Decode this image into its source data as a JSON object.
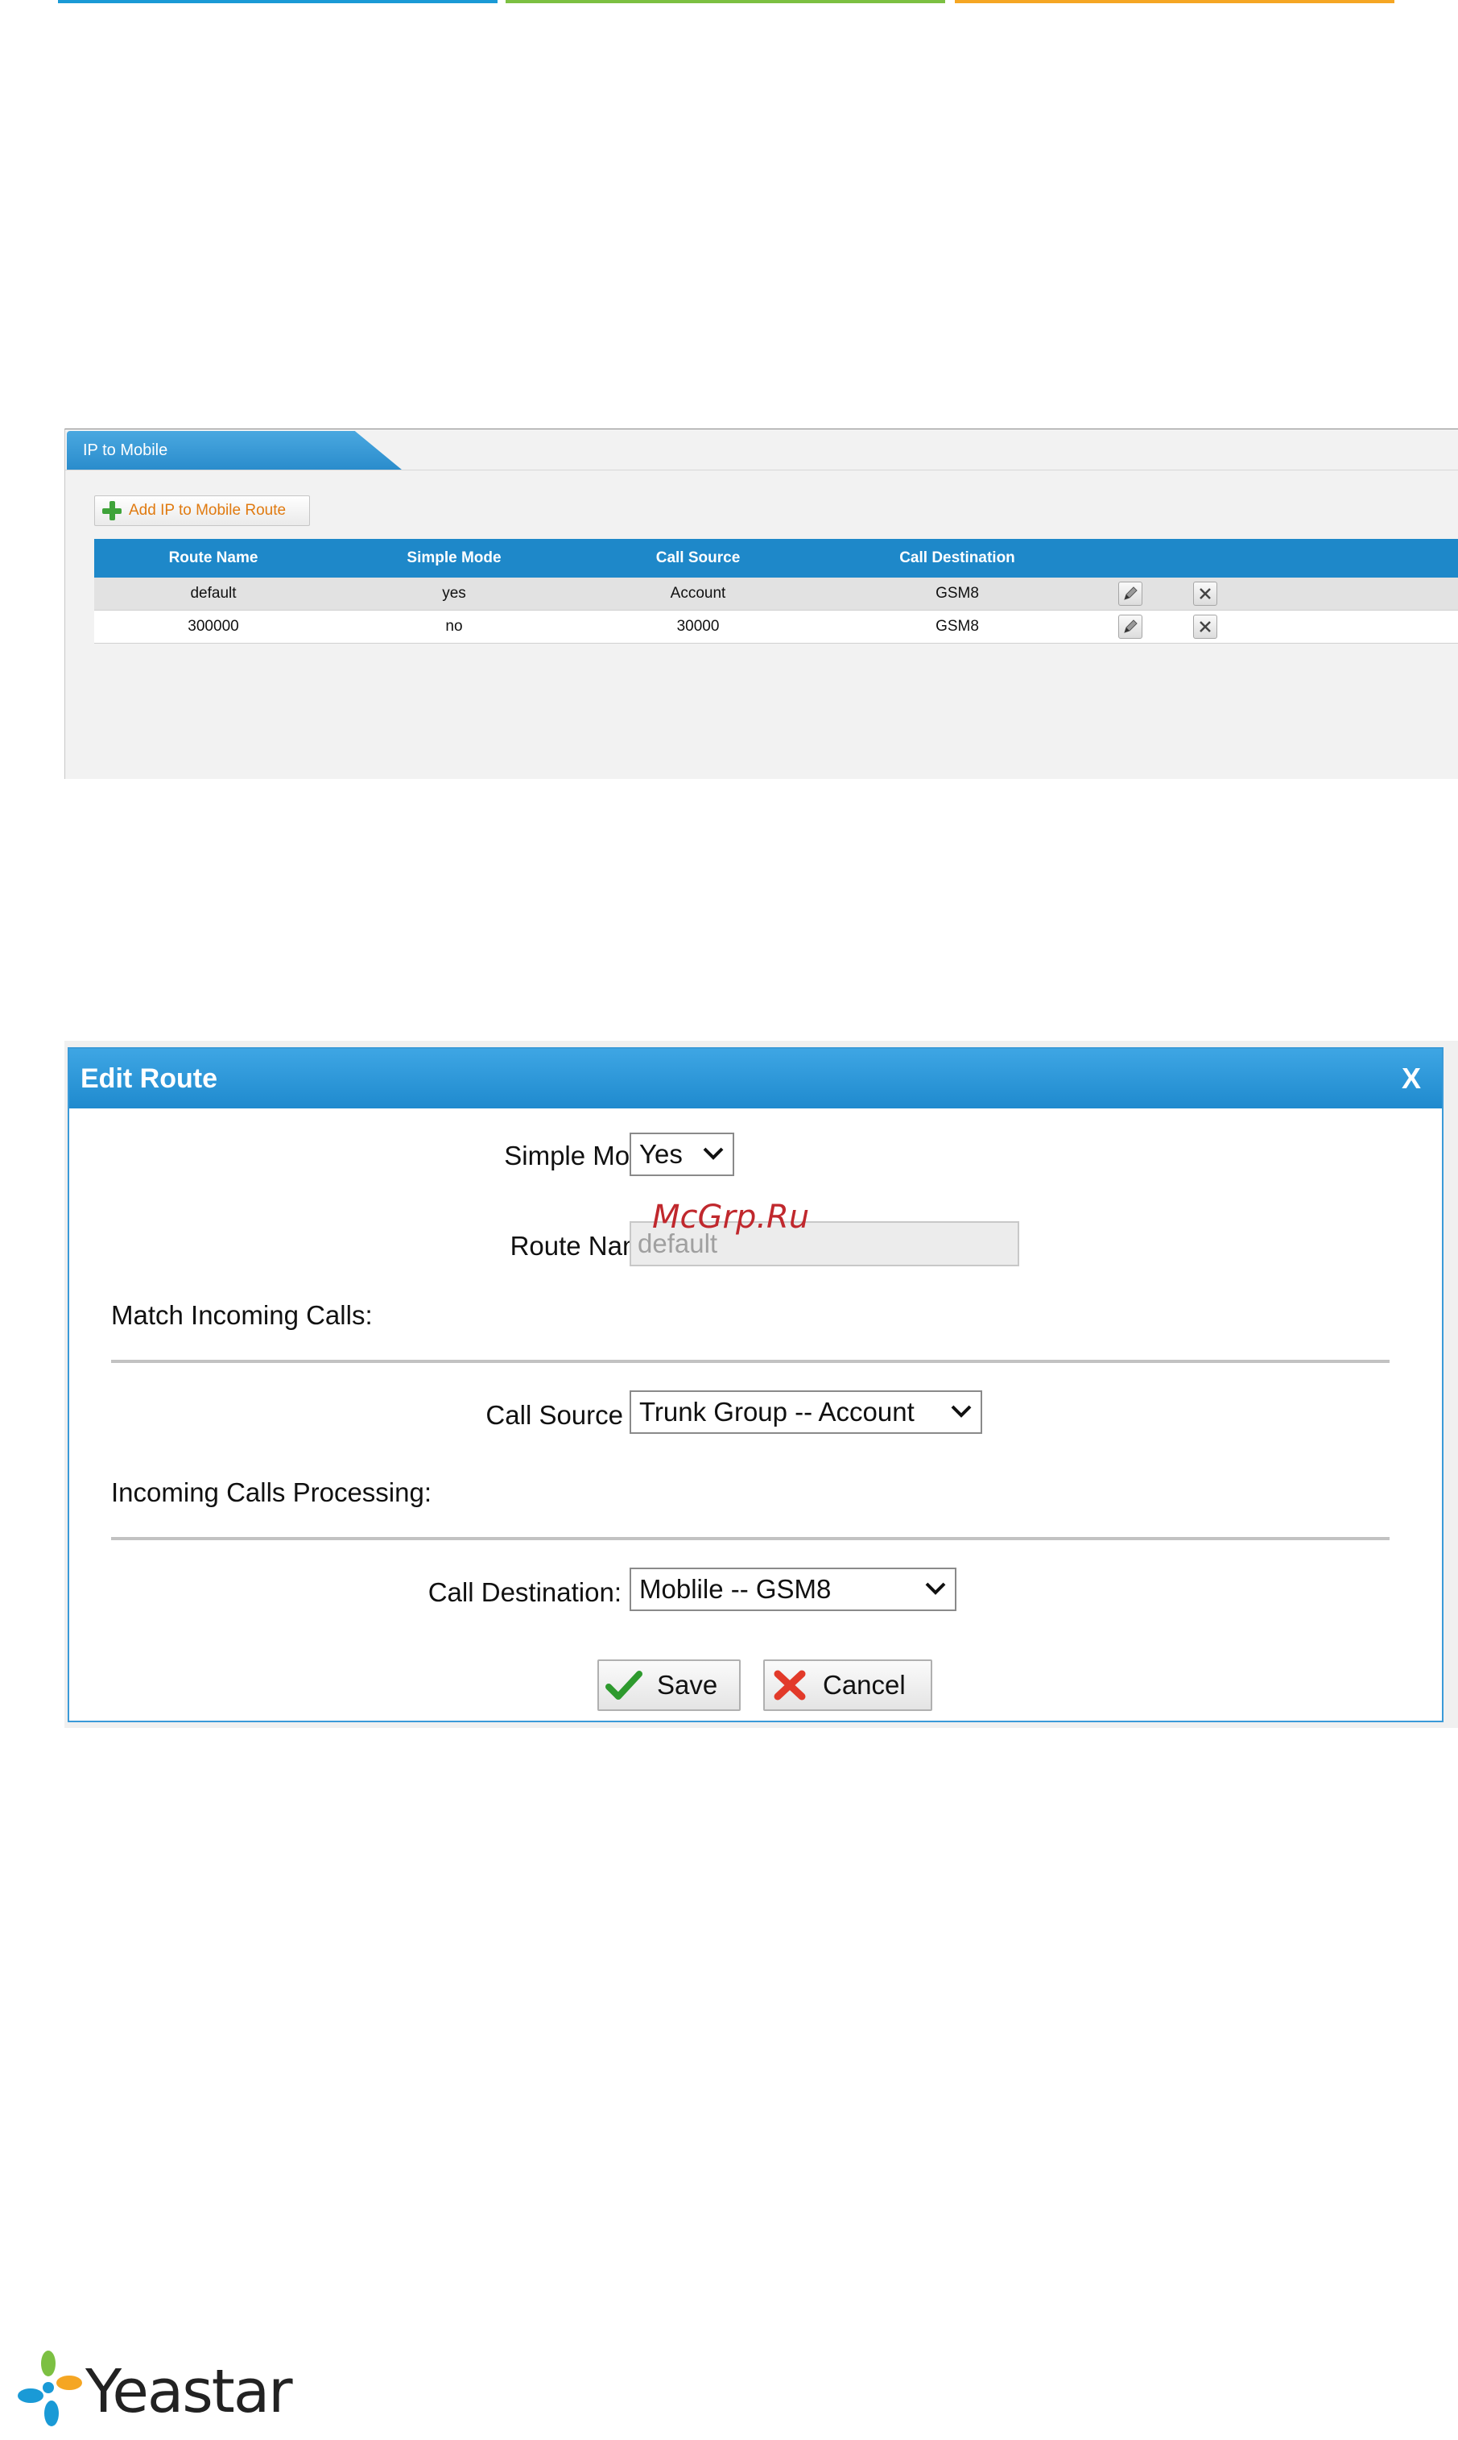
{
  "route_list": {
    "tab_title": "IP to Mobile",
    "add_button_label": "Add IP to Mobile Route",
    "columns": [
      "Route Name",
      "Simple Mode",
      "Call Source",
      "Call Destination"
    ],
    "rows": [
      {
        "route_name": "default",
        "simple_mode": "yes",
        "call_source": "Account",
        "call_destination": "GSM8"
      },
      {
        "route_name": "300000",
        "simple_mode": "no",
        "call_source": "30000",
        "call_destination": "GSM8"
      }
    ],
    "row_actions": [
      "edit-icon",
      "delete-icon"
    ]
  },
  "edit_route": {
    "title": "Edit Route",
    "close_label": "X",
    "simple_mode_label": "Simple Mode",
    "simple_mode_value": "Yes",
    "route_name_label": "Route Name",
    "route_name_placeholder": "default",
    "match_section": "Match Incoming Calls:",
    "call_source_label": "Call Source",
    "call_source_value": "Trunk Group -- Account",
    "processing_section": "Incoming Calls Processing:",
    "call_destination_label": "Call Destination:",
    "call_destination_value": "Moblile -- GSM8",
    "save_label": "Save",
    "cancel_label": "Cancel",
    "colon": ":"
  },
  "watermark": "McGrp.Ru",
  "brand": {
    "name": "Yeastar",
    "colors": {
      "blue": "#1a9ad6",
      "green": "#7cc042",
      "orange": "#f5a623"
    }
  }
}
